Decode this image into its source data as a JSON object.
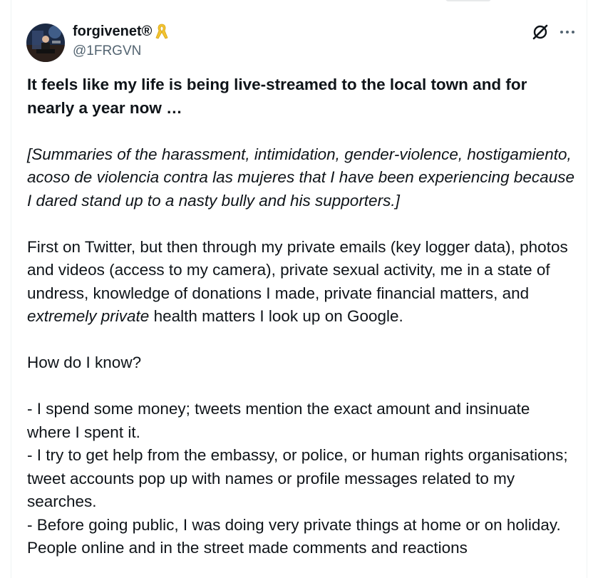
{
  "author": {
    "display_name": "forgivenet®",
    "handle": "@1FRGVN",
    "badge_icon": "yellow-ribbon-icon",
    "badge_color": "#f4c430"
  },
  "actions": {
    "grok_icon": "grok-icon",
    "more_icon": "more-icon"
  },
  "post": {
    "headline": "It feels like my life is being live-streamed to the local town and for nearly a year now …",
    "summary_note": "[Summaries of the harassment, intimidation, gender-violence, hostigamiento, acoso de violencia contra las mujeres that I have been experiencing because I dared stand up to a nasty bully and his supporters.]",
    "para1_part1": "First on Twitter, but then through my private emails (key logger data), photos and videos (access to my camera), private sexual activity, me in a state of undress, knowledge of donations I made, private financial matters, and ",
    "para1_emph": "extremely private",
    "para1_part2": " health matters I look up on Google.",
    "question": "How do I know?",
    "bullet1": "- I spend some money; tweets mention the exact amount and insinuate where I spent it.",
    "bullet2": "- I try to get help from the embassy, or police, or human rights organisations; tweet accounts pop up with names or profile messages related to my searches.",
    "bullet3": "- Before going public, I was doing very private things at home or on holiday. People online and in the street made comments and reactions"
  },
  "colors": {
    "text": "#0f1419",
    "secondary": "#536471",
    "border": "#eff3f4"
  }
}
